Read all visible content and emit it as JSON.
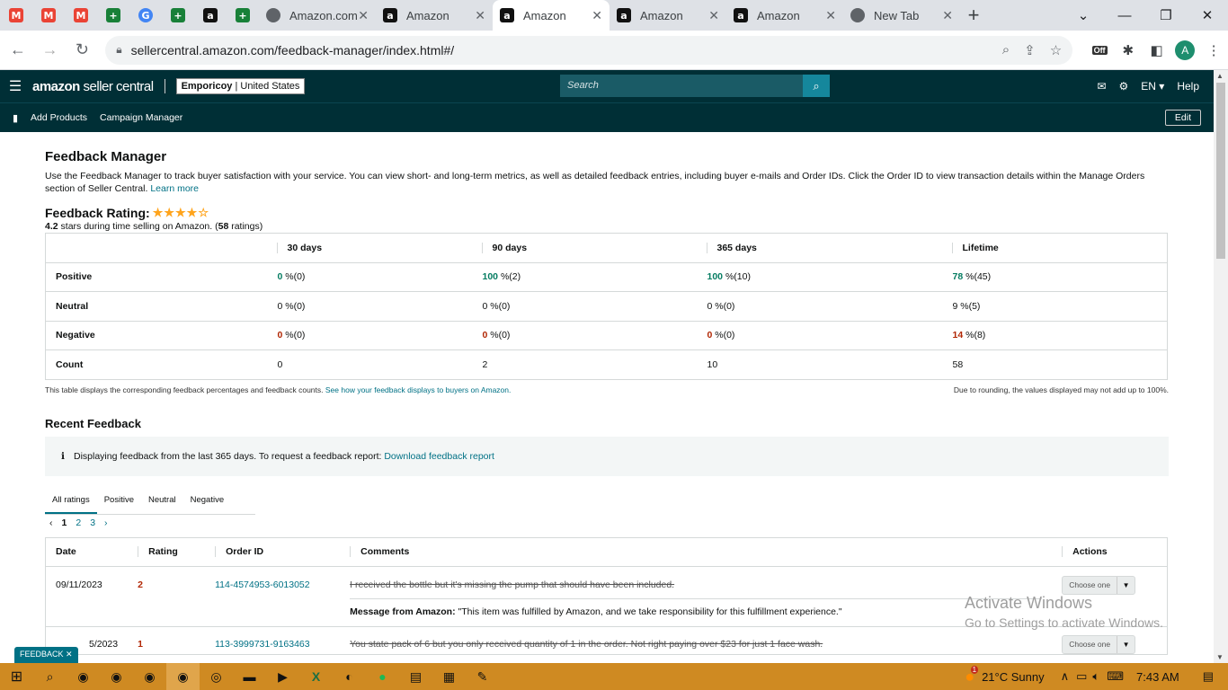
{
  "browser": {
    "tabs": [
      {
        "label": "",
        "icon": "gmail-icon",
        "pinned": true
      },
      {
        "label": "",
        "icon": "gmail-icon",
        "pinned": true
      },
      {
        "label": "",
        "icon": "gmail-icon",
        "pinned": true
      },
      {
        "label": "",
        "icon": "sheets-icon",
        "pinned": true
      },
      {
        "label": "",
        "icon": "google-icon",
        "pinned": true
      },
      {
        "label": "",
        "icon": "sheets-icon",
        "pinned": true
      },
      {
        "label": "",
        "icon": "amazon-icon",
        "pinned": true
      },
      {
        "label": "",
        "icon": "sheets-icon",
        "pinned": true
      },
      {
        "label": "Amazon.com",
        "icon": "globe-icon"
      },
      {
        "label": "Amazon",
        "icon": "amazon-icon"
      },
      {
        "label": "Amazon",
        "icon": "amazon-icon",
        "active": true
      },
      {
        "label": "Amazon",
        "icon": "amazon-icon"
      },
      {
        "label": "Amazon",
        "icon": "amazon-icon"
      },
      {
        "label": "New Tab",
        "icon": "chrome-icon"
      }
    ],
    "url": "sellercentral.amazon.com/feedback-manager/index.html#/",
    "profile_initial": "A",
    "extension_badge": "Off"
  },
  "seller_central": {
    "logo_bold": "amazon",
    "logo_rest": " seller central",
    "store_name": "Emporicoy",
    "store_region": " | United States",
    "search_placeholder": "Search",
    "language": "EN",
    "help": "Help",
    "nav": [
      "Add Products",
      "Campaign Manager"
    ],
    "edit": "Edit"
  },
  "page": {
    "title": "Feedback Manager",
    "intro": "Use the Feedback Manager to track buyer satisfaction with your service. You can view short- and long-term metrics, as well as detailed feedback entries, including buyer e-mails and Order IDs. Click the Order ID to view transaction details within the Manage Orders section of Seller Central.",
    "learn_more": "Learn more",
    "rating_title": "Feedback Rating:",
    "rating_value": "4.2",
    "rating_stars": 4,
    "rating_sub_mid": " stars during time selling on Amazon. (",
    "rating_count": "58",
    "rating_sub_end": " ratings)",
    "metrics": {
      "headers": [
        "",
        "30 days",
        "90 days",
        "365 days",
        "Lifetime"
      ],
      "rows": [
        {
          "label": "Positive",
          "cells": [
            {
              "v": "0",
              "s": " %(0)"
            },
            {
              "v": "100",
              "s": " %(2)"
            },
            {
              "v": "100",
              "s": " %(10)"
            },
            {
              "v": "78",
              "s": " %(45)"
            }
          ]
        },
        {
          "label": "Neutral",
          "cells": [
            {
              "v": "0",
              "s": " %(0)"
            },
            {
              "v": "0",
              "s": " %(0)"
            },
            {
              "v": "0",
              "s": " %(0)"
            },
            {
              "v": "9",
              "s": " %(5)"
            }
          ]
        },
        {
          "label": "Negative",
          "cells": [
            {
              "v": "0",
              "s": " %(0)"
            },
            {
              "v": "0",
              "s": " %(0)"
            },
            {
              "v": "0",
              "s": " %(0)"
            },
            {
              "v": "14",
              "s": " %(8)"
            }
          ]
        },
        {
          "label": "Count",
          "cells": [
            {
              "v": "0",
              "s": ""
            },
            {
              "v": "2",
              "s": ""
            },
            {
              "v": "10",
              "s": ""
            },
            {
              "v": "58",
              "s": ""
            }
          ]
        }
      ]
    },
    "note_left": "This table displays the corresponding feedback percentages and feedback counts.",
    "note_left_link": "See how your feedback displays to buyers on Amazon.",
    "note_right": "Due to rounding, the values displayed may not add up to 100%.",
    "recent_title": "Recent Feedback",
    "info_text": "Displaying feedback from the last 365 days. To request a feedback report:",
    "info_link": "Download feedback report",
    "filter_tabs": [
      "All ratings",
      "Positive",
      "Neutral",
      "Negative"
    ],
    "pages": [
      "1",
      "2",
      "3"
    ],
    "feedback_headers": [
      "Date",
      "Rating",
      "Order ID",
      "Comments",
      "Actions"
    ],
    "feedback": [
      {
        "date": "09/11/2023",
        "rating": "2",
        "order": "114-4574953-6013052",
        "comment": "I received the bottle but it's missing the pump that should have been included.",
        "msg_label": "Message from Amazon:",
        "msg": " \"This item was fulfilled by Amazon, and we take responsibility for this fulfillment experience.\"",
        "action": "Choose one"
      },
      {
        "date": "5/2023",
        "rating": "1",
        "order": "113-3999731-9163463",
        "comment": "You state pack of 6 but you only received quantity of 1 in the order. Not right paying over $23 for just 1 face wash.",
        "action": "Choose one"
      }
    ],
    "feedback_widget": "FEEDBACK"
  },
  "watermark": {
    "line1": "Activate Windows",
    "line2": "Go to Settings to activate Windows."
  },
  "taskbar": {
    "weather_badge": "1",
    "weather": "21°C  Sunny",
    "time": "7:43 AM"
  }
}
